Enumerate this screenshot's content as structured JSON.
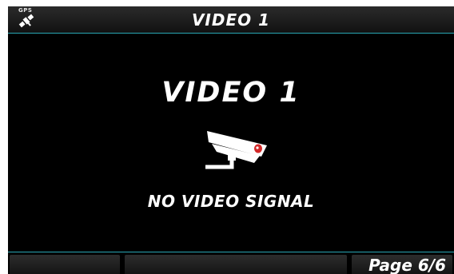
{
  "header": {
    "gps_label": "GPS",
    "title": "VIDEO 1"
  },
  "main": {
    "title": "VIDEO 1",
    "status": "NO VIDEO SIGNAL",
    "icon": "security-camera-icon"
  },
  "footer": {
    "page_label": "Page 6/6"
  },
  "colors": {
    "background": "#000000",
    "accent": "#2aa7b5",
    "text": "#ffffff",
    "camera_light": "#d22828"
  }
}
